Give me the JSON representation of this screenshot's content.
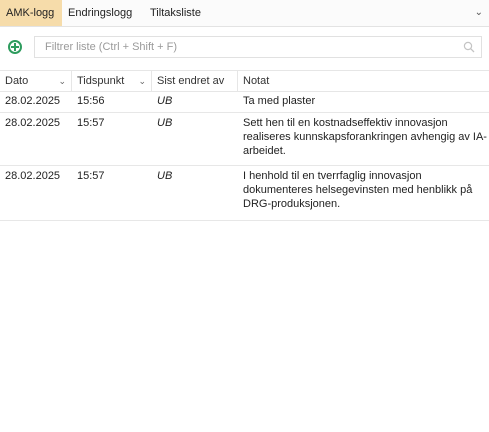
{
  "tabs": [
    {
      "label": "AMK-logg",
      "active": true
    },
    {
      "label": "Endringslogg",
      "active": false
    },
    {
      "label": "Tiltaksliste",
      "active": false
    }
  ],
  "tab_menu_icon": "chevron-down-icon",
  "filter": {
    "add_icon": "add-circle-icon",
    "placeholder": "Filtrer liste (Ctrl + Shift + F)",
    "search_icon": "search-icon"
  },
  "columns": [
    {
      "label": "Dato",
      "sort_icon": "chevron-down-icon"
    },
    {
      "label": "Tidspunkt",
      "sort_icon": "chevron-down-icon"
    },
    {
      "label": "Sist endret av",
      "sort_icon": ""
    },
    {
      "label": "Notat",
      "sort_icon": ""
    }
  ],
  "rows": [
    {
      "date": "28.02.2025",
      "time": "15:56",
      "user": "UB",
      "note": "Ta med plaster"
    },
    {
      "date": "28.02.2025",
      "time": "15:57",
      "user": "UB",
      "note": "Sett hen til en kostnadseffektiv innovasjon realiseres kunnskapsforankringen avhengig av IA-arbeidet."
    },
    {
      "date": "28.02.2025",
      "time": "15:57",
      "user": "UB",
      "note": "I henhold til en tverrfaglig innovasjon dokumenteres helsegevinsten med henblikk på DRG-produksjonen."
    }
  ],
  "colors": {
    "active_tab": "#f6dcaa",
    "add_icon": "#2e9c5e"
  }
}
